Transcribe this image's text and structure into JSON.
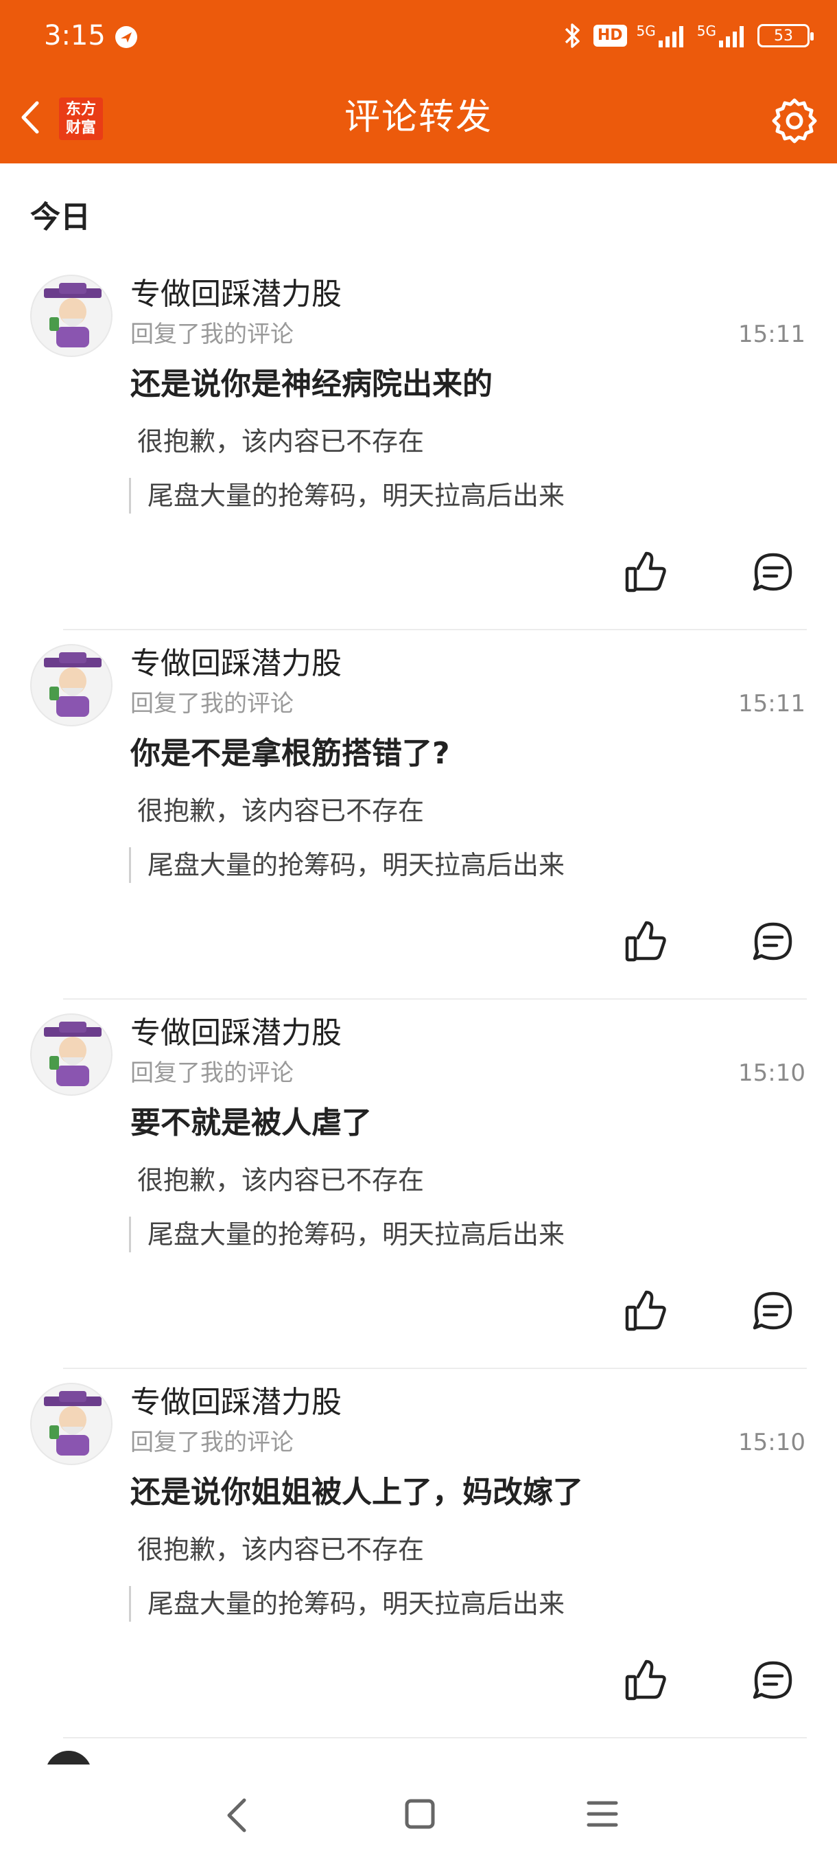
{
  "status_bar": {
    "time": "3:15",
    "battery": "53",
    "network_1": "5G",
    "network_2": "5G",
    "hd_badge": "HD",
    "icons": [
      "notification-icon",
      "bluetooth-icon",
      "hd-icon",
      "signal-icon",
      "signal-icon",
      "battery-icon"
    ]
  },
  "header": {
    "title": "评论转发",
    "logo_line1": "东方",
    "logo_line2": "财富",
    "back_icon": "chevron-left-icon",
    "settings_icon": "gear-icon",
    "bg_color": "#EC5A0C"
  },
  "section": {
    "title": "今日"
  },
  "items": [
    {
      "name": "专做回踩潜力股",
      "subtitle": "回复了我的评论",
      "time": "15:11",
      "comment": "还是说你是神经病院出来的",
      "deleted_text": "很抱歉，该内容已不存在",
      "quote": "尾盘大量的抢筹码，明天拉高后出来"
    },
    {
      "name": "专做回踩潜力股",
      "subtitle": "回复了我的评论",
      "time": "15:11",
      "comment": "你是不是拿根筋搭错了?",
      "deleted_text": "很抱歉，该内容已不存在",
      "quote": "尾盘大量的抢筹码，明天拉高后出来"
    },
    {
      "name": "专做回踩潜力股",
      "subtitle": "回复了我的评论",
      "time": "15:10",
      "comment": "要不就是被人虐了",
      "deleted_text": "很抱歉，该内容已不存在",
      "quote": "尾盘大量的抢筹码，明天拉高后出来"
    },
    {
      "name": "专做回踩潜力股",
      "subtitle": "回复了我的评论",
      "time": "15:10",
      "comment": "还是说你姐姐被人上了，妈改嫁了",
      "deleted_text": "很抱歉，该内容已不存在",
      "quote": "尾盘大量的抢筹码，明天拉高后出来"
    }
  ],
  "bottom_nav": {
    "icons": [
      "back-icon",
      "home-icon",
      "menu-icon"
    ]
  }
}
